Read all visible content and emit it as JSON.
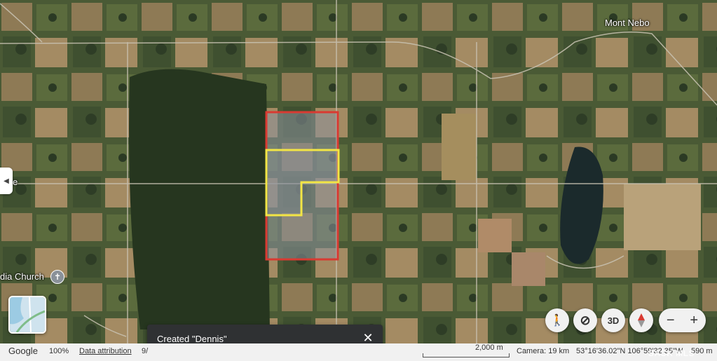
{
  "map": {
    "place_labels": {
      "mont_nebo": "Mont Nebo",
      "church": "dia Church",
      "side_label": "e"
    },
    "overlay_colors": {
      "outer_boundary": "#d93a32",
      "selected_parcel": "#f2e545"
    }
  },
  "controls": {
    "pegman_icon": "pegman-icon",
    "tilt_icon": "tilt-icon",
    "view_3d_label": "3D",
    "compass_icon": "compass-icon",
    "zoom_out_label": "−",
    "zoom_in_label": "+"
  },
  "toast": {
    "message": "Created \"Dennis\"",
    "close_label": "✕"
  },
  "status_bar": {
    "brand": "Google",
    "zoom_percent": "100%",
    "data_attribution": "Data attribution",
    "truncated_prefix": "9/",
    "scale_label": "2,000 m",
    "camera": "Camera: 19 km",
    "coordinates": "53°16'36.02\"N 106°59'32.35\"W",
    "elevation": "590 m"
  },
  "watermark": "SASK MLS"
}
